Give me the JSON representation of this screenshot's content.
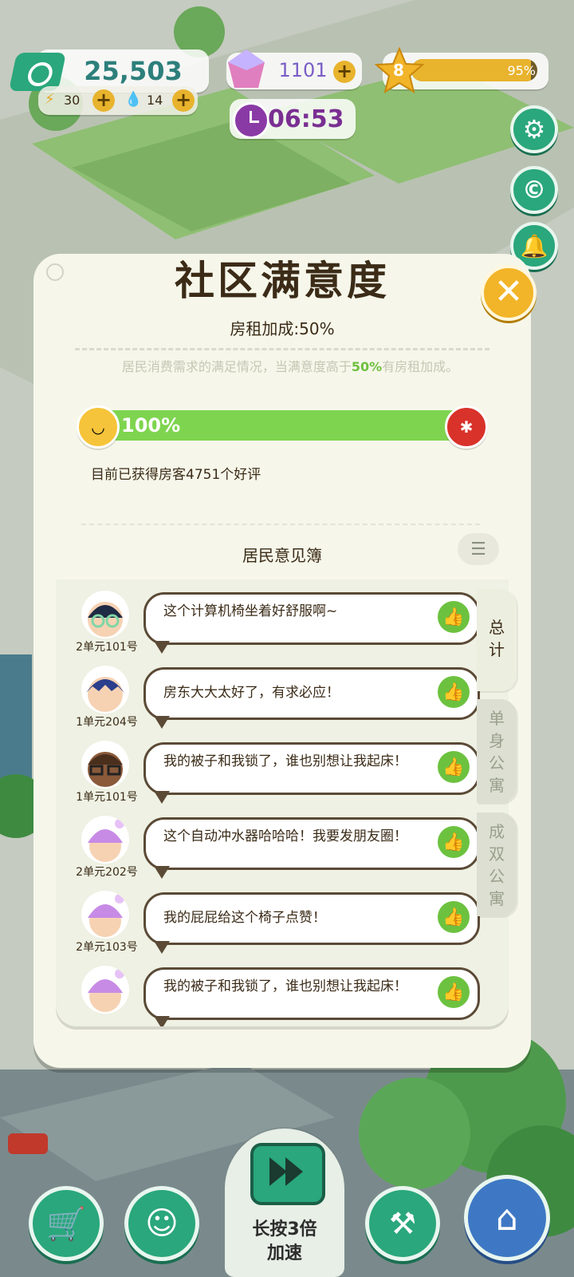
{
  "hud": {
    "money": "25,503",
    "energy": "30",
    "water": "14",
    "gems": "1101",
    "level": "8",
    "level_progress_text": "95%",
    "level_progress": 0.95,
    "timer": "06:53"
  },
  "side_buttons": [
    "gear-icon",
    "coin-c-icon",
    "bell-icon"
  ],
  "modal": {
    "title": "社区满意度",
    "rent_bonus": "房租加成:50%",
    "desc_before": "居民消费需求的满足情况，当满意度高于",
    "desc_highlight": "50%",
    "desc_after": "有房租加成。",
    "satisfaction_text": "100%",
    "satisfaction": 1.0,
    "reviews": "目前已获得房客4751个好评",
    "book_title": "居民意见簿",
    "close_icon": "close-icon"
  },
  "tabs": [
    {
      "label": "总计",
      "active": true
    },
    {
      "label": "单身公寓",
      "active": false
    },
    {
      "label": "成双公寓",
      "active": false
    }
  ],
  "comments": [
    {
      "room": "2单元101号",
      "text": "这个计算机椅坐着好舒服啊~",
      "avatar": "glasses-girl"
    },
    {
      "room": "1单元204号",
      "text": "房东大大太好了，有求必应！",
      "avatar": "blue-hair-boy"
    },
    {
      "room": "1单元101号",
      "text": "我的被子和我锁了，谁也别想让我起床！",
      "avatar": "brown-glasses"
    },
    {
      "room": "2单元202号",
      "text": "这个自动冲水器哈哈哈！我要发朋友圈！",
      "avatar": "purple-hat"
    },
    {
      "room": "2单元103号",
      "text": "我的屁屁给这个椅子点赞！",
      "avatar": "purple-hat"
    },
    {
      "room": "",
      "text": "我的被子和我锁了，谁也别想让我起床！",
      "avatar": "purple-hat"
    }
  ],
  "bottom": {
    "speed_label": "长按3倍加速",
    "buttons": [
      "cart-icon",
      "smile-icon",
      "tools-icon",
      "home-build-icon"
    ]
  },
  "colors": {
    "green": "#2aa77c",
    "bar": "#7ed44f",
    "gold": "#f2b428"
  }
}
